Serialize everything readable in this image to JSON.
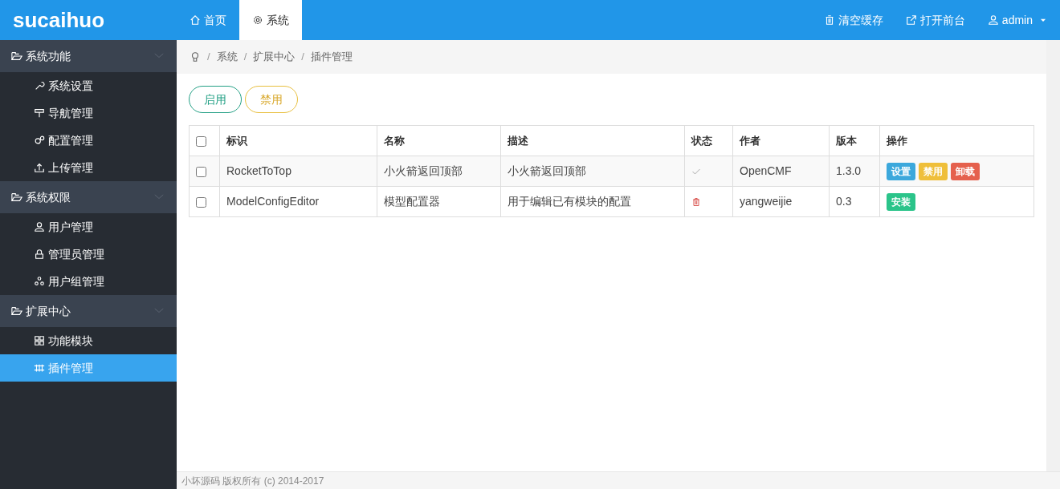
{
  "brand": "sucaihuo",
  "top_tabs": [
    {
      "label": "首页",
      "kind": "home",
      "selected": false
    },
    {
      "label": "系统",
      "kind": "gear",
      "selected": true
    }
  ],
  "top_links": [
    {
      "label": "清空缓存",
      "kind": "trash"
    },
    {
      "label": "打开前台",
      "kind": "external"
    },
    {
      "label": "admin",
      "kind": "user",
      "dropdown": true
    }
  ],
  "sidebar": [
    {
      "label": "系统功能",
      "expanded": true,
      "children": [
        {
          "label": "系统设置",
          "kind": "wrench",
          "selected": false
        },
        {
          "label": "导航管理",
          "kind": "sign",
          "selected": false
        },
        {
          "label": "配置管理",
          "kind": "cogs",
          "selected": false
        },
        {
          "label": "上传管理",
          "kind": "upload",
          "selected": false
        }
      ]
    },
    {
      "label": "系统权限",
      "expanded": true,
      "children": [
        {
          "label": "用户管理",
          "kind": "user",
          "selected": false
        },
        {
          "label": "管理员管理",
          "kind": "lock",
          "selected": false
        },
        {
          "label": "用户组管理",
          "kind": "group",
          "selected": false
        }
      ]
    },
    {
      "label": "扩展中心",
      "expanded": true,
      "children": [
        {
          "label": "功能模块",
          "kind": "grid",
          "selected": false
        },
        {
          "label": "插件管理",
          "kind": "plugin",
          "selected": true
        }
      ]
    }
  ],
  "breadcrumb": [
    {
      "separator": "/",
      "label": "系统"
    },
    {
      "separator": "/",
      "label": "扩展中心"
    },
    {
      "separator": "/",
      "label": "插件管理"
    }
  ],
  "toolbar": [
    {
      "label": "启用",
      "kind": "enable"
    },
    {
      "label": "禁用",
      "kind": "disable"
    }
  ],
  "table": {
    "select_all_checked": false,
    "columns": [
      "标识",
      "名称",
      "描述",
      "状态",
      "作者",
      "版本",
      "操作"
    ],
    "rows": [
      {
        "checked": false,
        "id": "RocketToTop",
        "name": "小火箭返回顶部",
        "description": "小火箭返回顶部",
        "status": {
          "kind": "installed"
        },
        "author": "OpenCMF",
        "version": "1.3.0",
        "actions": [
          {
            "label": "设置",
            "kind": "settings"
          },
          {
            "label": "禁用",
            "kind": "disable"
          },
          {
            "label": "卸载",
            "kind": "uninstall"
          }
        ]
      },
      {
        "checked": false,
        "id": "ModelConfigEditor",
        "name": "模型配置器",
        "description": "用于编辑已有模块的配置",
        "status": {
          "kind": "uninstalled"
        },
        "author": "yangweijie",
        "version": "0.3",
        "actions": [
          {
            "label": "安装",
            "kind": "install"
          }
        ]
      }
    ]
  },
  "footer": "小坏源码 版权所有 (c) 2014-2017"
}
